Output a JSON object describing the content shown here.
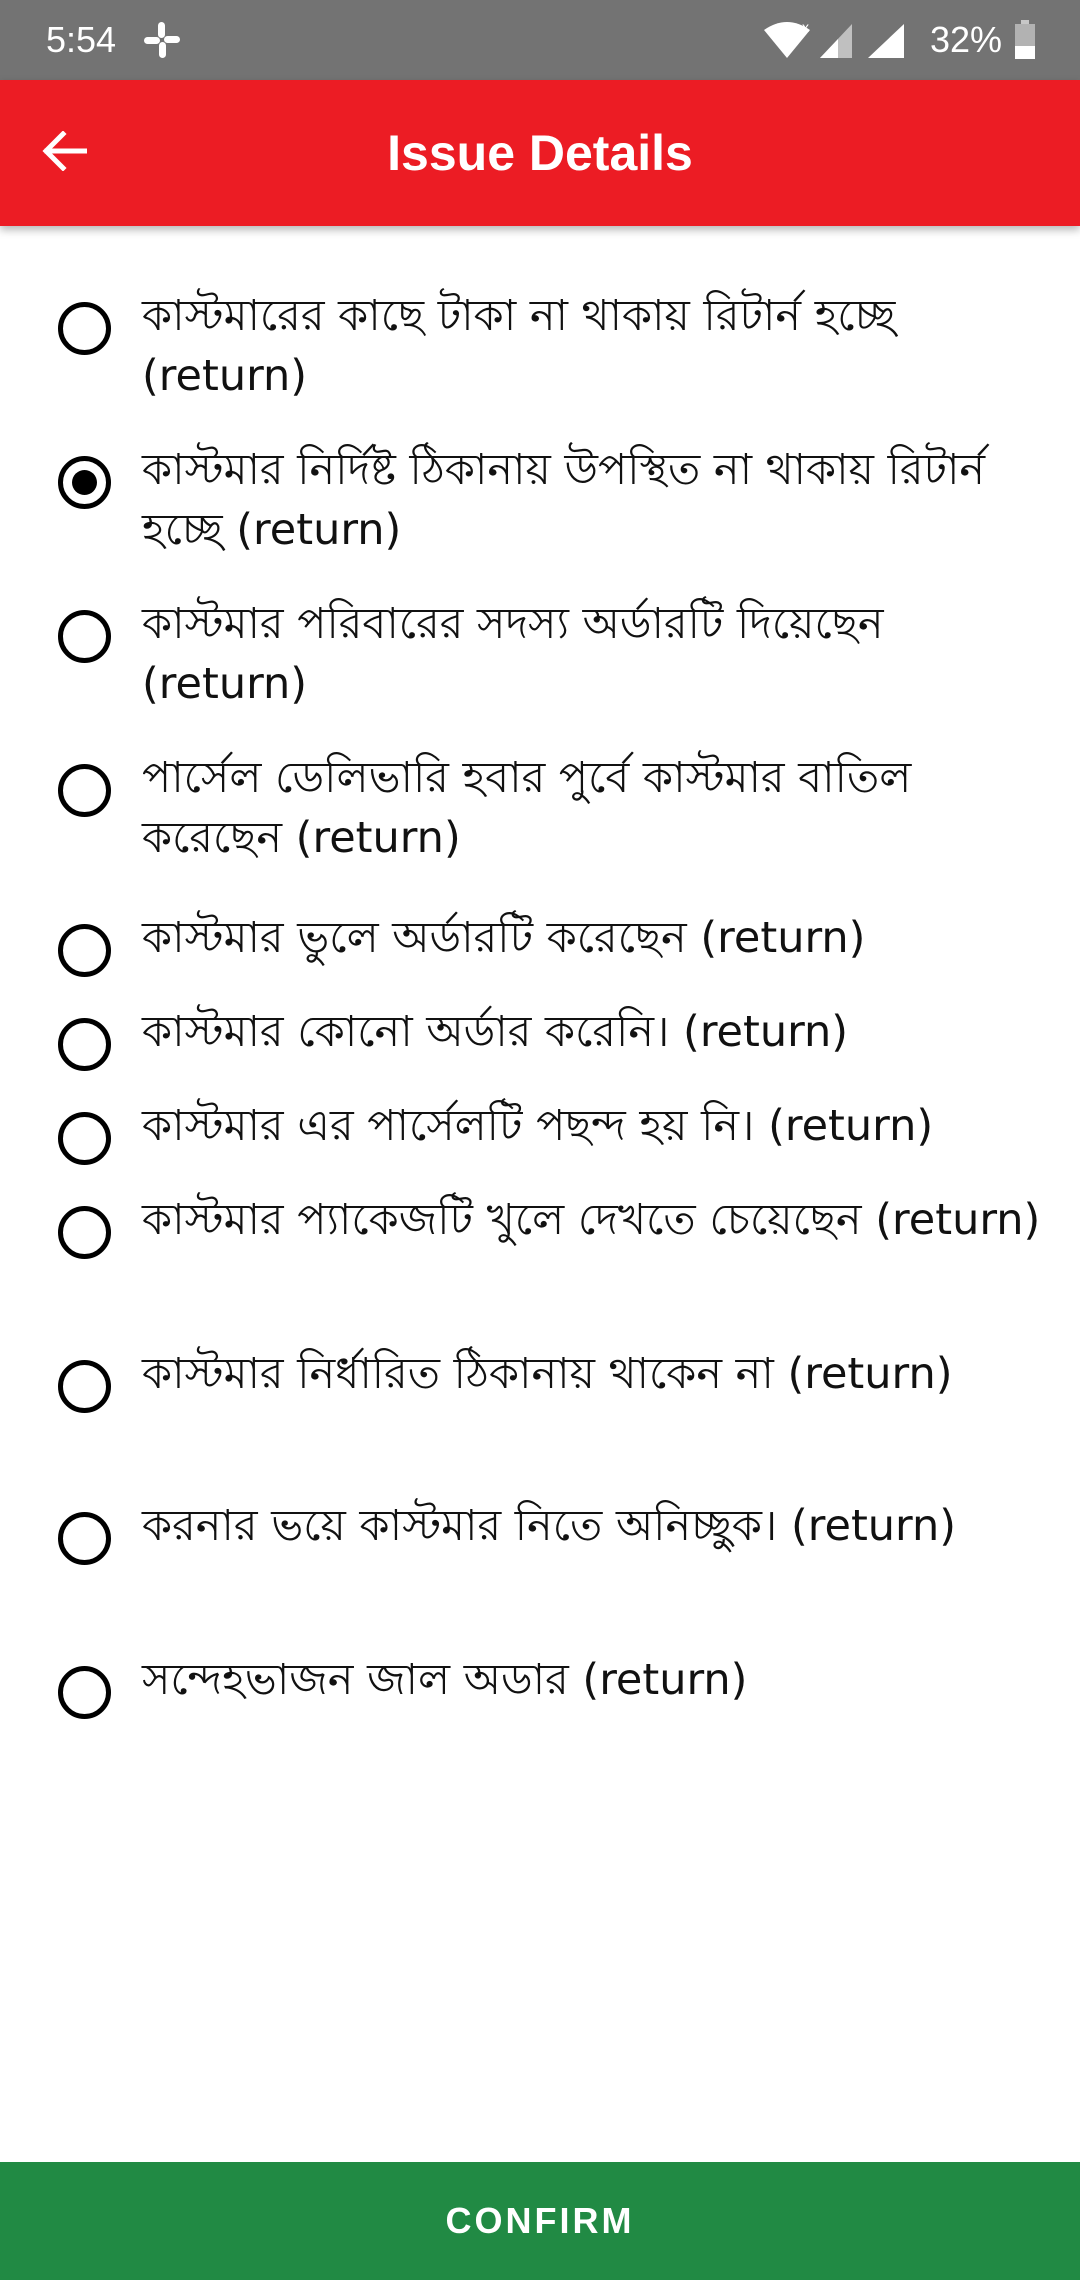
{
  "status_bar": {
    "time": "5:54",
    "battery": "32%",
    "icons": [
      "slack-icon",
      "wifi-icon",
      "signal-icon",
      "battery-icon"
    ]
  },
  "app_bar": {
    "title": "Issue Details",
    "back_icon": "arrow-back-icon",
    "color": "#ec1c24"
  },
  "options": [
    {
      "label": "কাস্টমারের কাছে টাকা না থাকায় রিটার্ন হচ্ছে (return)",
      "selected": false
    },
    {
      "label": "কাস্টমার নির্দিষ্ট ঠিকানায় উপস্থিত না থাকায় রিটার্ন  হচ্ছে  (return)",
      "selected": true
    },
    {
      "label": "কাস্টমার পরিবারের সদস্য অর্ডারটি দিয়েছেন (return)",
      "selected": false
    },
    {
      "label": "পার্সেল ডেলিভারি হবার পুর্বে কাস্টমার বাতিল করেছেন (return)",
      "selected": false
    },
    {
      "label": "কাস্টমার ভুলে অর্ডারটি করেছেন (return)",
      "selected": false
    },
    {
      "label": "কাস্টমার কোনো অর্ডার করেনি। (return)",
      "selected": false
    },
    {
      "label": "কাস্টমার এর পার্সেলটি পছন্দ হয় নি। (return)",
      "selected": false
    },
    {
      "label": "কাস্টমার প্যাকেজটি খুলে দেখতে চেয়েছেন (return)",
      "selected": false
    },
    {
      "label": "কাস্টমার নির্ধারিত ঠিকানায় থাকেন না (return)",
      "selected": false
    },
    {
      "label": "করনার ভয়ে কাস্টমার নিতে অনিচ্ছুক। (return)",
      "selected": false
    },
    {
      "label": "সন্দেহভাজন জাল অডার (return)",
      "selected": false
    }
  ],
  "confirm": {
    "label": "CONFIRM",
    "color": "#218a44"
  }
}
